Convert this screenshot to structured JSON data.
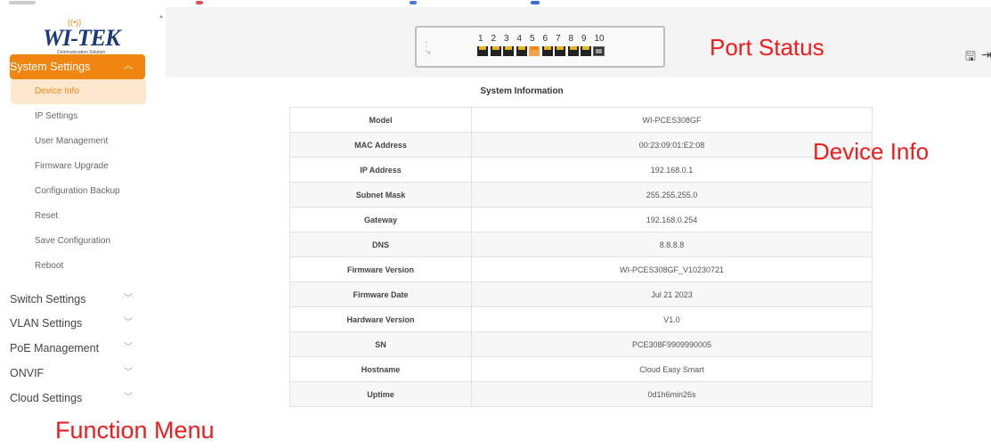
{
  "brand": {
    "logo_text": "WI-TEK",
    "tagline": "Communication Solution"
  },
  "annotations": {
    "port_status": "Port Status",
    "device_info": "Device Info",
    "function_menu": "Function Menu"
  },
  "sidebar": {
    "groups": [
      {
        "label": "System Settings",
        "expanded": true,
        "items": [
          {
            "label": "Device Info",
            "selected": true
          },
          {
            "label": "IP Settings"
          },
          {
            "label": "User Management"
          },
          {
            "label": "Firmware Upgrade"
          },
          {
            "label": "Configuration Backup"
          },
          {
            "label": "Reset"
          },
          {
            "label": "Save Configuration"
          },
          {
            "label": "Reboot"
          }
        ]
      },
      {
        "label": "Switch Settings"
      },
      {
        "label": "VLAN Settings"
      },
      {
        "label": "PoE Management"
      },
      {
        "label": "ONVIF"
      },
      {
        "label": "Cloud Settings"
      }
    ]
  },
  "ports": {
    "labels": [
      "1",
      "2",
      "3",
      "4",
      "5",
      "6",
      "7",
      "8",
      "9",
      "10"
    ],
    "active_port": "5"
  },
  "header_icons": [
    "save-icon",
    "logout-icon"
  ],
  "system_info": {
    "title": "System Information",
    "rows": [
      {
        "label": "Model",
        "value": "WI-PCES308GF"
      },
      {
        "label": "MAC Address",
        "value": "00:23:09:01:E2:08"
      },
      {
        "label": "IP Address",
        "value": "192.168.0.1"
      },
      {
        "label": "Subnet Mask",
        "value": "255.255.255.0"
      },
      {
        "label": "Gateway",
        "value": "192.168.0.254"
      },
      {
        "label": "DNS",
        "value": "8.8.8.8"
      },
      {
        "label": "Firmware Version",
        "value": "WI-PCES308GF_V10230721"
      },
      {
        "label": "Firmware Date",
        "value": "Jul 21 2023"
      },
      {
        "label": "Hardware Version",
        "value": "V1.0"
      },
      {
        "label": "SN",
        "value": "PCE308F9909990005"
      },
      {
        "label": "Hostname",
        "value": "Cloud Easy Smart"
      },
      {
        "label": "Uptime",
        "value": "0d1h6min26s"
      }
    ]
  },
  "colors": {
    "accent": "#f08512",
    "selected_bg": "#fde7cf",
    "annotation": "#ee1c1c",
    "logo": "#1a3a7a"
  }
}
